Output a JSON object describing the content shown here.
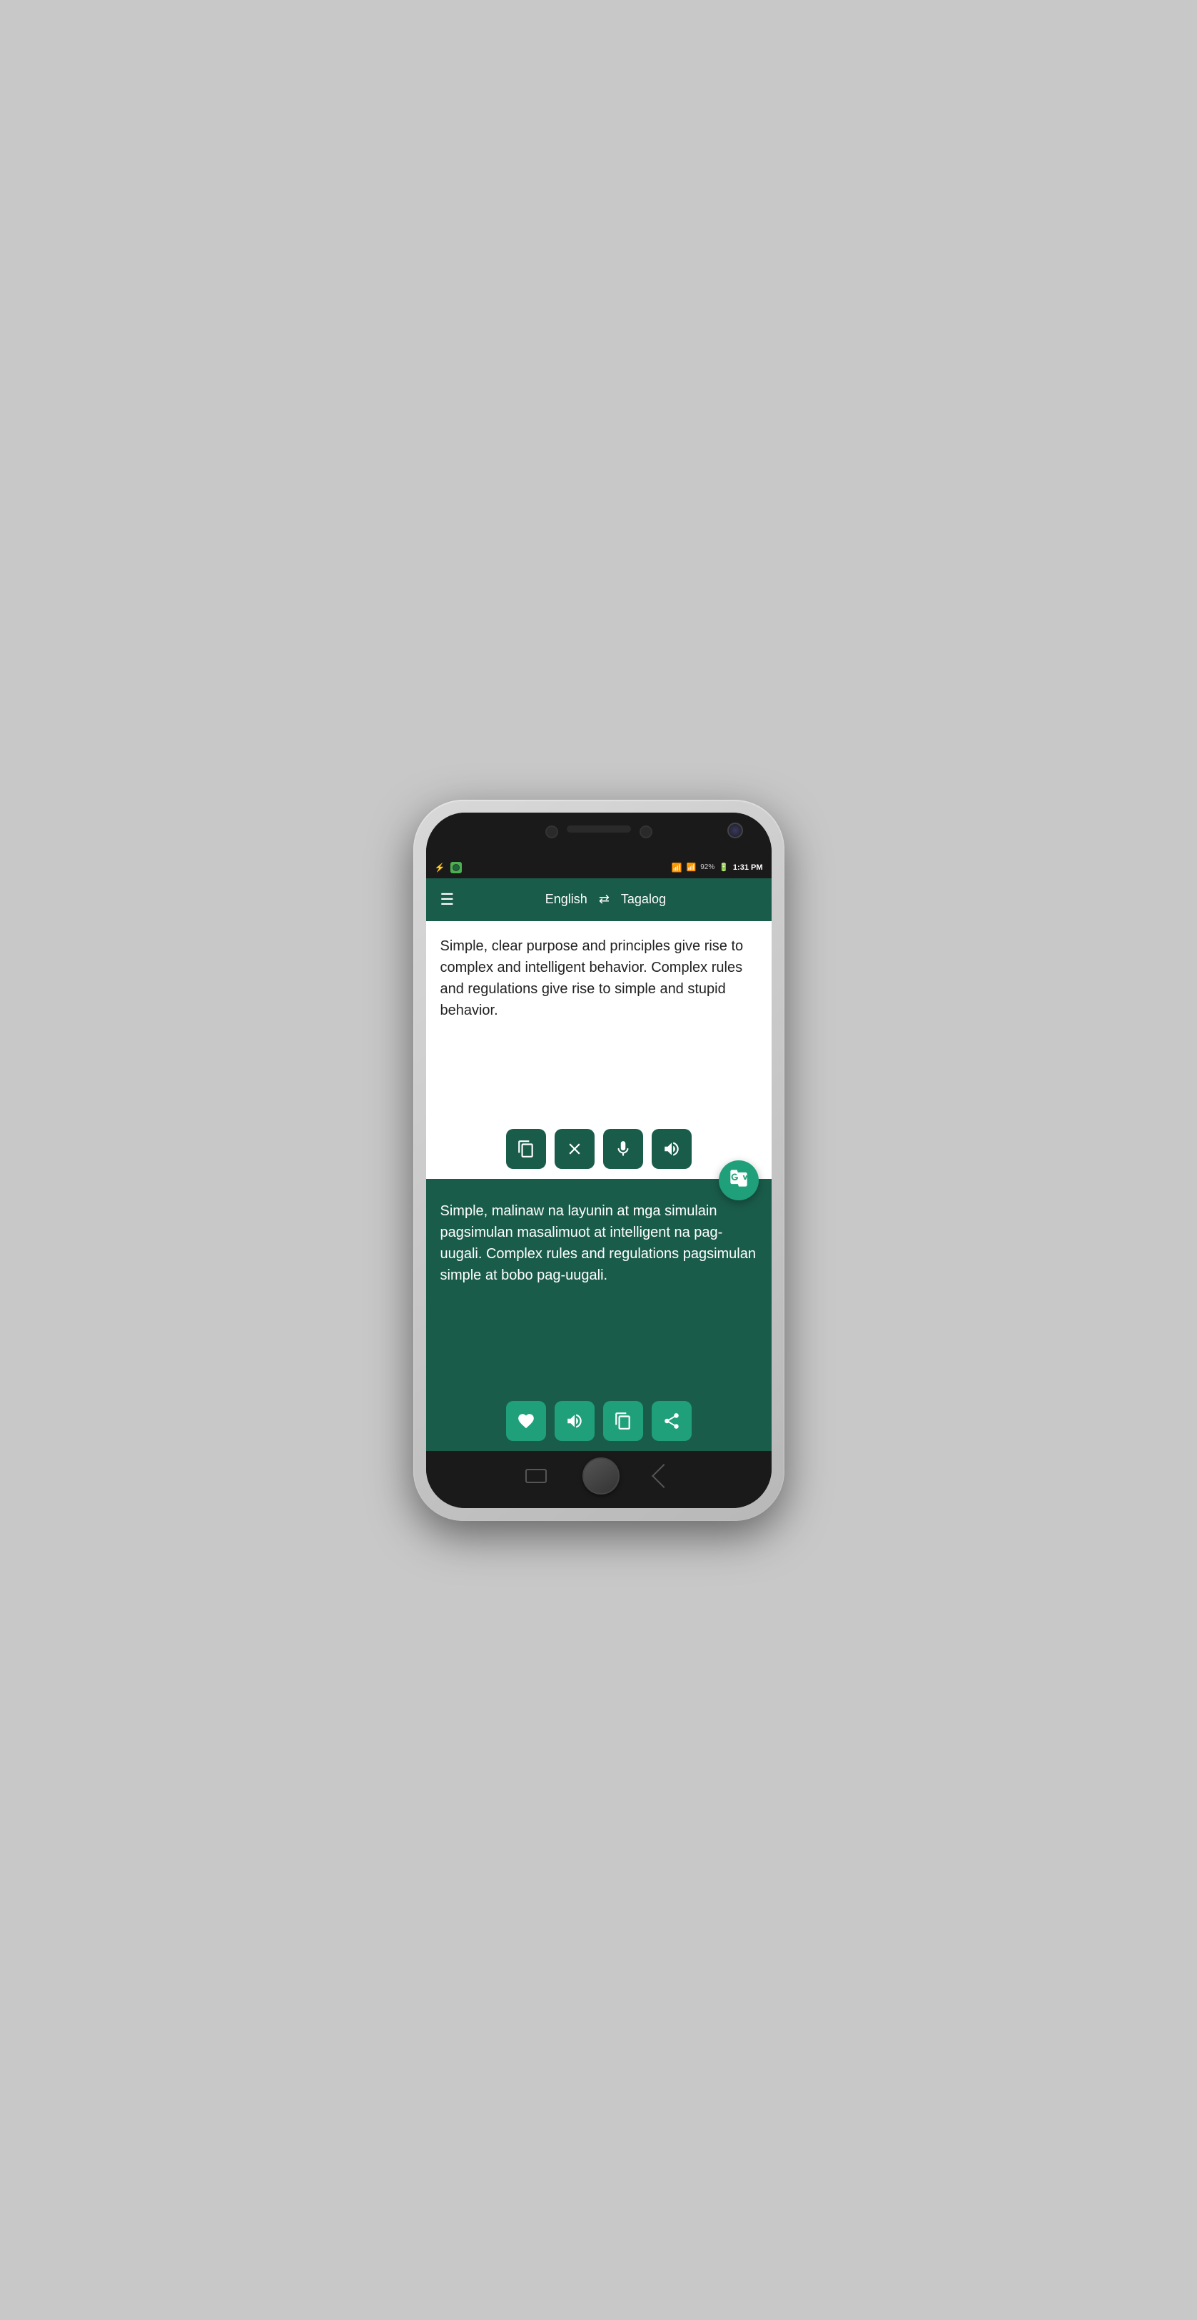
{
  "statusBar": {
    "time": "1:31 PM",
    "battery": "92%",
    "batteryIcon": "⚡",
    "wifiIcon": "WiFi",
    "signalIcon": "Signal"
  },
  "header": {
    "menuIcon": "☰",
    "sourceLang": "English",
    "swapIcon": "⇄",
    "targetLang": "Tagalog"
  },
  "inputArea": {
    "text": "Simple, clear purpose and principles give rise to complex and intelligent behavior. Complex rules and regulations give rise to simple and stupid behavior.",
    "clipboardBtn": "Clipboard",
    "clearBtn": "Clear",
    "micBtn": "Microphone",
    "speakerBtn": "Speaker",
    "googleTranslateLabel": "GT"
  },
  "outputArea": {
    "text": "Simple, malinaw na layunin at mga simulain pagsimulan masalimuot at intelligent na pag-uugali. Complex rules and regulations pagsimulan simple at bobo pag-uugali.",
    "favoriteBtn": "Favorite",
    "speakerBtn": "Speaker",
    "copyBtn": "Copy",
    "shareBtn": "Share"
  }
}
